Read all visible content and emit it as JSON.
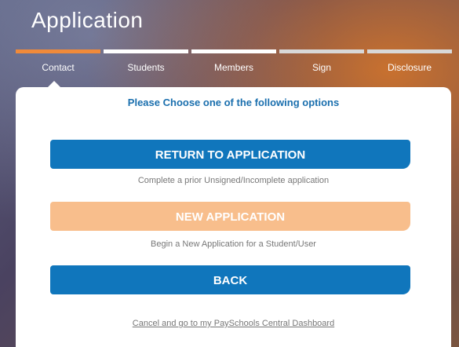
{
  "header": {
    "title": "Application"
  },
  "steps": [
    {
      "label": "Contact",
      "state": "active"
    },
    {
      "label": "Students",
      "state": "upcoming"
    },
    {
      "label": "Members",
      "state": "upcoming"
    },
    {
      "label": "Sign",
      "state": "upcoming"
    },
    {
      "label": "Disclosure",
      "state": "upcoming"
    }
  ],
  "card": {
    "prompt": "Please Choose one of the following options",
    "options": [
      {
        "label": "RETURN TO APPLICATION",
        "hint": "Complete a prior Unsigned/Incomplete application"
      },
      {
        "label": "NEW APPLICATION",
        "hint": "Begin a New Application for a Student/User"
      },
      {
        "label": "BACK"
      }
    ],
    "cancel_link": "Cancel and go to my PaySchools Central Dashboard"
  },
  "colors": {
    "accent_orange": "#f08a3a",
    "primary_blue": "#1076bc",
    "peach": "#f8be8c",
    "prompt_blue": "#1a6fae"
  }
}
